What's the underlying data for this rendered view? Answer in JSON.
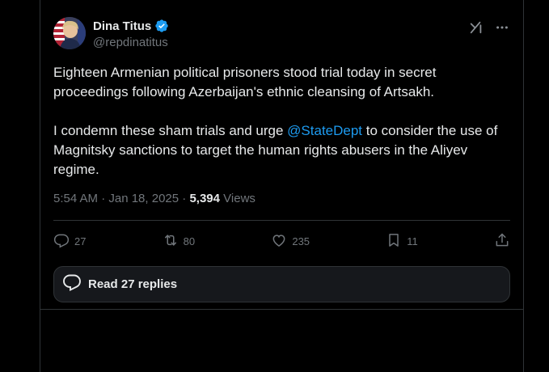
{
  "author": {
    "name": "Dina Titus",
    "handle": "@repdinatitus",
    "verified": true
  },
  "post": {
    "paragraph1": "Eighteen Armenian political prisoners stood trial today in secret proceedings following Azerbaijan's ethnic cleansing of Artsakh.",
    "paragraph2_before": "I condemn these sham trials and urge ",
    "mention": "@StateDept",
    "paragraph2_after": " to consider the use of Magnitsky sanctions to target the human rights abusers in the Aliyev regime."
  },
  "meta": {
    "timestamp": "5:54 AM · Jan 18, 2025",
    "separator": " · ",
    "views_count": "5,394",
    "views_label": " Views"
  },
  "actions": {
    "reply_count": "27",
    "repost_count": "80",
    "like_count": "235",
    "bookmark_count": "11"
  },
  "replies_button": {
    "label": "Read 27 replies"
  },
  "colors": {
    "background": "#000000",
    "text": "#e7e9ea",
    "secondary": "#71767b",
    "accent": "#1d9bf0",
    "border": "#2f3336"
  },
  "icons": [
    "verified-badge-icon",
    "grok-icon",
    "more-icon",
    "reply-icon",
    "repost-icon",
    "like-icon",
    "bookmark-icon",
    "share-icon",
    "replies-bubble-icon"
  ]
}
